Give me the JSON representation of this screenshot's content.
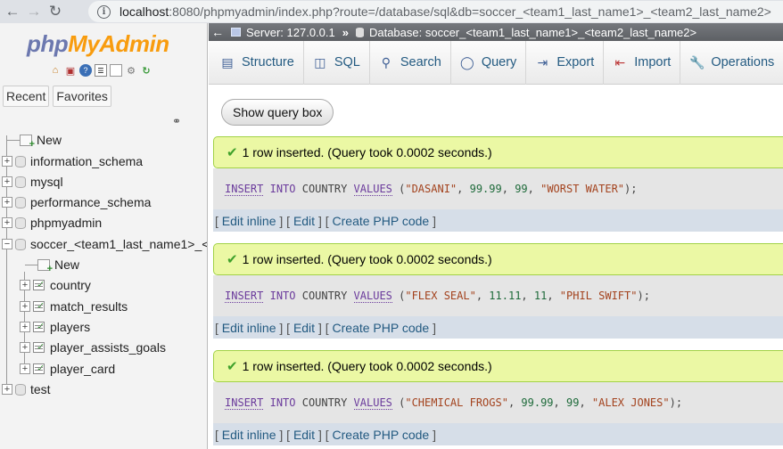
{
  "browser": {
    "url_host": "localhost",
    "url_path": ":8080/phpmyadmin/index.php?route=/database/sql&db=soccer_<team1_last_name1>_<team2_last_name2>"
  },
  "sidebar": {
    "logo_php": "php",
    "logo_myadmin": "MyAdmin",
    "tabs": [
      "Recent",
      "Favorites"
    ],
    "tree": [
      {
        "label": "New"
      },
      {
        "label": "information_schema"
      },
      {
        "label": "mysql"
      },
      {
        "label": "performance_schema"
      },
      {
        "label": "phpmyadmin"
      },
      {
        "label": "soccer_<team1_last_name1>_<t"
      },
      {
        "label": "New"
      },
      {
        "label": "country"
      },
      {
        "label": "match_results"
      },
      {
        "label": "players"
      },
      {
        "label": "player_assists_goals"
      },
      {
        "label": "player_card"
      },
      {
        "label": "test"
      }
    ]
  },
  "breadcrumb": {
    "server": "Server: 127.0.0.1",
    "database": "Database: soccer_<team1_last_name1>_<team2_last_name2>"
  },
  "menu": [
    "Structure",
    "SQL",
    "Search",
    "Query",
    "Export",
    "Import",
    "Operations"
  ],
  "show_query_label": "Show query box",
  "results": [
    {
      "message": "1 row inserted. (Query took 0.0002 seconds.)",
      "sql": {
        "kw1": "INSERT",
        "kw2": "INTO",
        "table": "COUNTRY",
        "kw3": "VALUES",
        "v1": "\"DASANI\"",
        "v2": "99.99",
        "v3": "99",
        "v4": "\"WORST WATER\""
      }
    },
    {
      "message": "1 row inserted. (Query took 0.0002 seconds.)",
      "sql": {
        "kw1": "INSERT",
        "kw2": "INTO",
        "table": "COUNTRY",
        "kw3": "VALUES",
        "v1": "\"FLEX SEAL\"",
        "v2": "11.11",
        "v3": "11",
        "v4": "\"PHIL SWIFT\""
      }
    },
    {
      "message": "1 row inserted. (Query took 0.0002 seconds.)",
      "sql": {
        "kw1": "INSERT",
        "kw2": "INTO",
        "table": "COUNTRY",
        "kw3": "VALUES",
        "v1": "\"CHEMICAL FROGS\"",
        "v2": "99.99",
        "v3": "99",
        "v4": "\"ALEX JONES\""
      }
    }
  ],
  "result_links": {
    "edit_inline": "Edit inline",
    "edit": "Edit",
    "create_php": "Create PHP code"
  }
}
